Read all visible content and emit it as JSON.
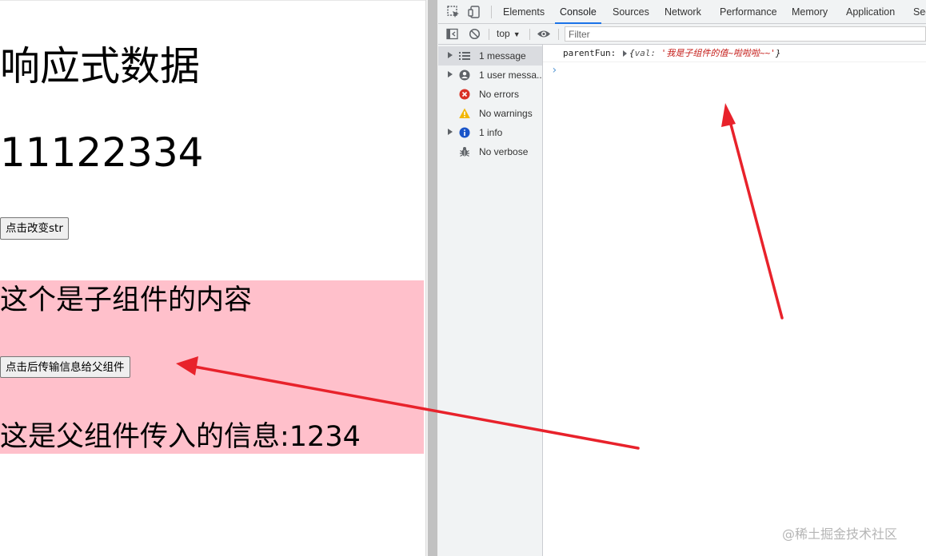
{
  "page": {
    "title": "响应式数据",
    "value": "11122334",
    "change_button": "点击改变str",
    "child": {
      "title": "这个是子组件的内容",
      "send_button": "点击后传输信息给父组件",
      "parent_info": "这是父组件传入的信息:1234"
    }
  },
  "devtools": {
    "tabs": [
      "Elements",
      "Console",
      "Sources",
      "Network",
      "Performance",
      "Memory",
      "Application",
      "Sec"
    ],
    "active_tab": "Console",
    "toolbar": {
      "context": "top",
      "filter_placeholder": "Filter"
    },
    "sidebar": [
      {
        "label": "1 message",
        "icon": "list-icon",
        "has_arrow": true,
        "selected": true
      },
      {
        "label": "1 user messa...",
        "icon": "user-icon",
        "has_arrow": true,
        "selected": false
      },
      {
        "label": "No errors",
        "icon": "error-icon",
        "has_arrow": false,
        "selected": false
      },
      {
        "label": "No warnings",
        "icon": "warning-icon",
        "has_arrow": false,
        "selected": false
      },
      {
        "label": "1 info",
        "icon": "info-icon",
        "has_arrow": true,
        "selected": false
      },
      {
        "label": "No verbose",
        "icon": "bug-icon",
        "has_arrow": false,
        "selected": false
      }
    ],
    "console_log": {
      "label": "parentFun:",
      "open_brace": "{",
      "key": "val:",
      "value": "'我是子组件的值~啦啦啦~~'",
      "close_brace": "}"
    },
    "prompt": "›"
  },
  "colors": {
    "child_bg": "#ffc0cb",
    "arrow": "#e8222b",
    "tab_accent": "#1a73e8",
    "error": "#d93025",
    "warning": "#f2b600",
    "info": "#1a55c9"
  },
  "watermark": "@稀土掘金技术社区"
}
